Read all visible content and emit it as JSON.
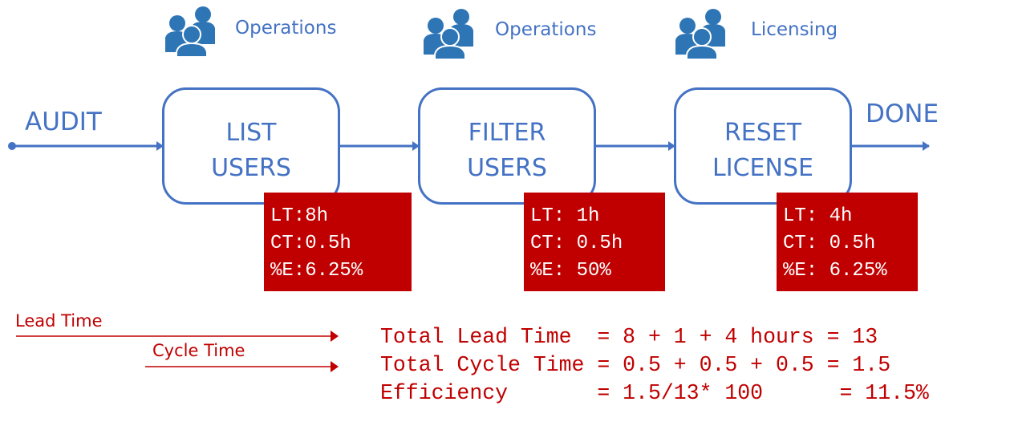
{
  "diagram": {
    "start_label": "AUDIT",
    "end_label": "DONE",
    "steps": [
      {
        "team": "Operations",
        "team_icon": "people-group-icon",
        "line1": "LIST",
        "line2": "USERS",
        "metrics": {
          "lt": "LT:8h",
          "ct": "CT:0.5h",
          "e": "%E:6.25%"
        }
      },
      {
        "team": "Operations",
        "team_icon": "people-group-icon",
        "line1": "FILTER",
        "line2": "USERS",
        "metrics": {
          "lt": "LT: 1h",
          "ct": "CT: 0.5h",
          "e": "%E: 50%"
        }
      },
      {
        "team": "Licensing",
        "team_icon": "people-group-icon",
        "line1": "RESET",
        "line2": "LICENSE",
        "metrics": {
          "lt": "LT: 4h",
          "ct": "CT: 0.5h",
          "e": "%E: 6.25%"
        }
      }
    ],
    "legend": {
      "lead_time": "Lead Time",
      "cycle_time": "Cycle Time"
    },
    "summary": [
      "Total Lead Time  = 8 + 1 + 4 hours = 13",
      "Total Cycle Time = 0.5 + 0.5 + 0.5 = 1.5",
      "Efficiency       = 1.5/13* 100      = 11.5%"
    ],
    "colors": {
      "flow": "#4472c4",
      "team_icon": "#2e75b6",
      "metric_bg": "#c00000",
      "metric_text": "#ffffff",
      "legend": "#c00000"
    }
  }
}
